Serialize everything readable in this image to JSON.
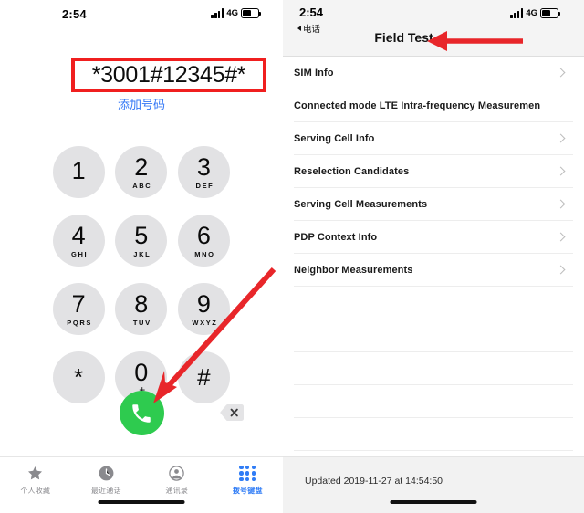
{
  "left_phone": {
    "status_bar": {
      "time": "2:54",
      "network": "4G",
      "signal_icon": "signal-bars-icon",
      "battery_icon": "battery-icon"
    },
    "dialed_number": "*3001#12345#*",
    "add_number_label": "添加号码",
    "keypad": [
      {
        "digit": "1",
        "letters": ""
      },
      {
        "digit": "2",
        "letters": "ABC"
      },
      {
        "digit": "3",
        "letters": "DEF"
      },
      {
        "digit": "4",
        "letters": "GHI"
      },
      {
        "digit": "5",
        "letters": "JKL"
      },
      {
        "digit": "6",
        "letters": "MNO"
      },
      {
        "digit": "7",
        "letters": "PQRS"
      },
      {
        "digit": "8",
        "letters": "TUV"
      },
      {
        "digit": "9",
        "letters": "WXYZ"
      },
      {
        "digit": "*",
        "letters": ""
      },
      {
        "digit": "0",
        "letters": "+"
      },
      {
        "digit": "#",
        "letters": ""
      }
    ],
    "call_button_icon": "phone-handset-icon",
    "backspace_icon": "backspace-delete-icon",
    "tabs": [
      {
        "label": "个人收藏",
        "icon": "star-icon",
        "active": false
      },
      {
        "label": "最近通话",
        "icon": "clock-icon",
        "active": false
      },
      {
        "label": "通讯录",
        "icon": "contacts-person-icon",
        "active": false
      },
      {
        "label": "拨号键盘",
        "icon": "keypad-dots-icon",
        "active": true
      }
    ]
  },
  "right_phone": {
    "status_bar": {
      "time": "2:54",
      "network": "4G",
      "signal_icon": "signal-bars-icon",
      "battery_icon": "battery-icon"
    },
    "back_label": "电话",
    "title": "Field Test",
    "rows": [
      {
        "label": "SIM Info",
        "chevron": true
      },
      {
        "label": "Connected mode LTE Intra-frequency Measuremen",
        "chevron": false
      },
      {
        "label": "Serving Cell Info",
        "chevron": true
      },
      {
        "label": "Reselection Candidates",
        "chevron": true
      },
      {
        "label": "Serving Cell Measurements",
        "chevron": true
      },
      {
        "label": "PDP Context Info",
        "chevron": true
      },
      {
        "label": "Neighbor Measurements",
        "chevron": true
      }
    ],
    "empty_row_count": 5,
    "updated_text": "Updated 2019-11-27 at 14:54:50"
  },
  "annotations": {
    "highlight_box_color": "#f01f1f",
    "arrow_color": "#e8262a",
    "accent_blue": "#3478f6",
    "call_green": "#2ecb4f"
  }
}
